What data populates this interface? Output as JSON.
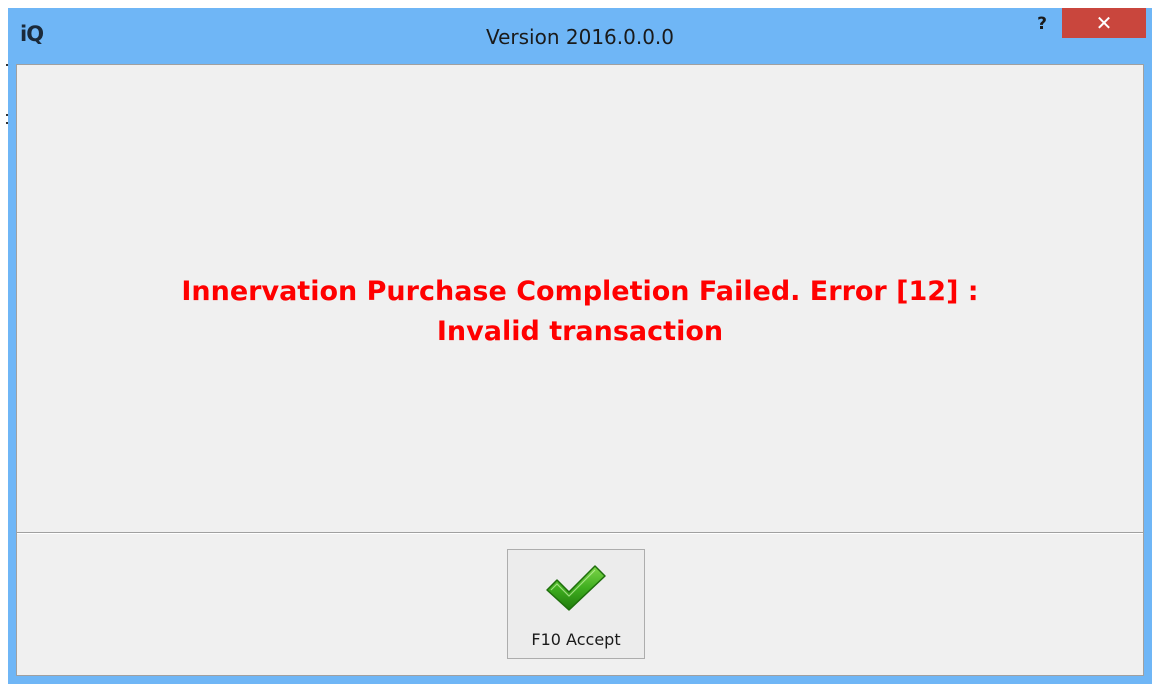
{
  "window": {
    "app_logo": "iQ",
    "title": "Version 2016.0.0.0",
    "help_label": "?",
    "close_label": "✕"
  },
  "message": {
    "line1": "Innervation Purchase Completion Failed. Error [12] :",
    "line2": "Invalid transaction",
    "color": "#ff0000"
  },
  "footer": {
    "accept_label": "F10 Accept",
    "accept_icon": "checkmark-icon"
  },
  "colors": {
    "titlebar": "#6fb6f6",
    "close_button": "#c9463d",
    "client_background": "#f0f0f0",
    "checkmark": "#2e9a12"
  }
}
